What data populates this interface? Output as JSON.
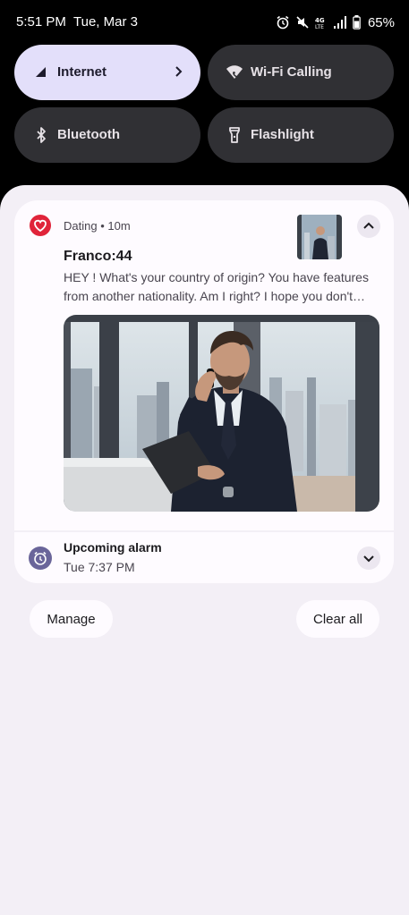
{
  "status_bar": {
    "time": "5:51 PM",
    "date": "Tue, Mar 3",
    "network": "4G LTE",
    "battery": "65%",
    "icons": [
      "alarm-icon",
      "mute-icon",
      "lte-icon",
      "signal-icon",
      "battery-icon"
    ]
  },
  "quick_settings": {
    "tiles": [
      {
        "label": "Internet",
        "icon": "signal-icon",
        "active": true
      },
      {
        "label": "Wi-Fi Calling",
        "icon": "wifi-calling-icon",
        "active": false
      },
      {
        "label": "Bluetooth",
        "icon": "bluetooth-icon",
        "active": false
      },
      {
        "label": "Flashlight",
        "icon": "flashlight-icon",
        "active": false
      }
    ]
  },
  "notification": {
    "app_name": "Dating",
    "time_ago": "10m",
    "meta": "Dating • 10m",
    "title": "Franco:44",
    "body": "HEY ! What's your country of origin? You have features from another nationality. Am I right? I hope you don't mind me asking.",
    "app_icon": "heart-icon",
    "accent_color": "#e0243a"
  },
  "alarm": {
    "title": "Upcoming alarm",
    "time": "Tue 7:37 PM",
    "icon": "alarm-clock-icon",
    "accent_color": "#6a659a"
  },
  "actions": {
    "manage_label": "Manage",
    "clear_all_label": "Clear all"
  }
}
